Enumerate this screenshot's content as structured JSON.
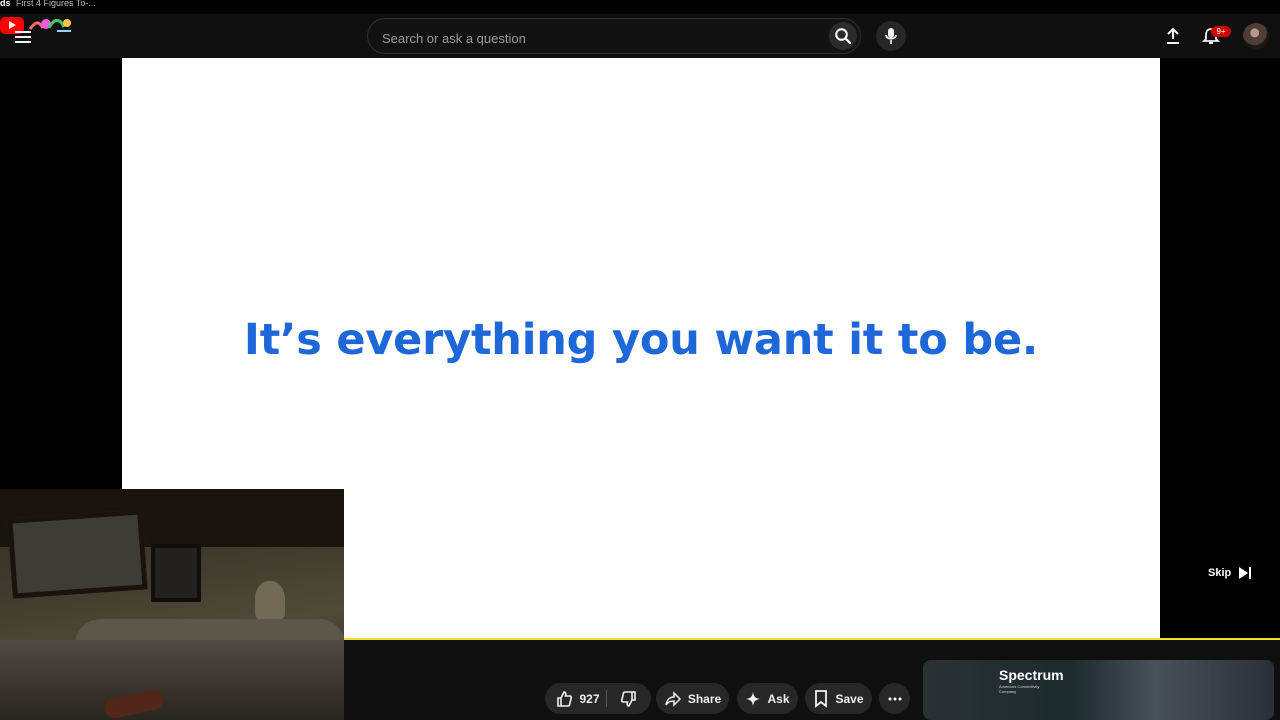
{
  "tab": {
    "prefix": "ds",
    "title": "First 4 Figures To-..."
  },
  "header": {
    "logo_name": "youtube-logo",
    "search": {
      "placeholder": "Search or ask a question",
      "value": ""
    },
    "notifications_badge": "9+"
  },
  "video": {
    "ad_message": "It’s everything you want it to be.",
    "skip_label": "Skip",
    "ad_progress_fraction": 1.0,
    "progress_color": "#efe32b"
  },
  "actions": {
    "like_count": "927",
    "share_label": "Share",
    "ask_label": "Ask",
    "save_label": "Save"
  },
  "recommended": {
    "brand": "Spectrum",
    "tagline": "America's Connectivity Company"
  },
  "colors": {
    "accent": "#1d67d9",
    "youtube_red": "#ff0000",
    "background": "#0f0f0f"
  }
}
